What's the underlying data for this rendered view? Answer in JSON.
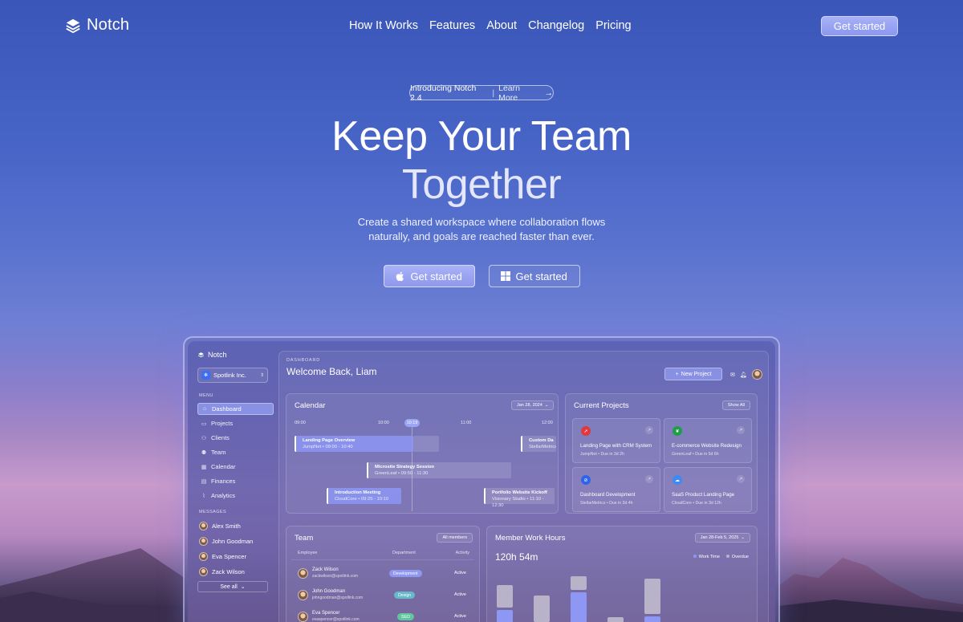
{
  "brand": {
    "name": "Notch",
    "logo_icon": "stacked-layers-icon"
  },
  "nav": {
    "links": [
      "How It Works",
      "Features",
      "About",
      "Changelog",
      "Pricing"
    ],
    "cta": "Get started"
  },
  "hero": {
    "pill_intro": "Introducing Notch 2.4",
    "pill_divider": "|",
    "pill_link": "Learn More",
    "title_line1": "Keep Your Team",
    "title_line2": "Together",
    "subtitle_line1": "Create a shared workspace where collaboration flows",
    "subtitle_line2": "naturally, and goals are reached faster than ever.",
    "cta_mac": {
      "label": "Get started",
      "icon": "apple-icon"
    },
    "cta_windows": {
      "label": "Get started",
      "icon": "windows-icon"
    }
  },
  "dashboard": {
    "brand": "Notch",
    "org": "Spotlink Inc.",
    "menu_heading": "MENU",
    "menu": [
      {
        "label": "Dashboard",
        "icon": "home-icon",
        "active": true
      },
      {
        "label": "Projects",
        "icon": "folder-icon"
      },
      {
        "label": "Clients",
        "icon": "users-icon"
      },
      {
        "label": "Team",
        "icon": "team-icon"
      },
      {
        "label": "Calendar",
        "icon": "calendar-icon"
      },
      {
        "label": "Finances",
        "icon": "wallet-icon"
      },
      {
        "label": "Analytics",
        "icon": "chart-icon"
      }
    ],
    "messages_heading": "MESSAGES",
    "messages": [
      "Alex Smith",
      "John Goodman",
      "Eva Spencer",
      "Zack Wilson"
    ],
    "see_all": "See all",
    "breadcrumb": "DASHBOARD",
    "welcome": "Welcome Back, Liam",
    "new_project": "New Project",
    "calendar": {
      "title": "Calendar",
      "date": "Jan 28, 2024",
      "times": [
        "09:00",
        "10:00",
        "11:00",
        "12:00"
      ],
      "now": "10:19",
      "events": [
        {
          "title": "Landing Page Overview",
          "meta": "JumpNet  •  09:00 - 10:40"
        },
        {
          "title": "Custom Da",
          "meta": "StellarMetrics"
        },
        {
          "title": "Microsite Strategy Session",
          "meta": "GreenLeaf  •  09:50 - 11:30"
        },
        {
          "title": "Introduction Meeting",
          "meta": "CloudCore  •  09:25 - 10:10"
        },
        {
          "title": "Portfolio Website Kickoff",
          "meta": "Visionary Studio  •  11:10 - 12:30"
        }
      ]
    },
    "projects": {
      "title": "Current Projects",
      "show_all": "Show All",
      "items": [
        {
          "title": "Landing Page with CRM System",
          "client": "JumpNet",
          "due": "Due in 3d 2h",
          "color": "#e0393f"
        },
        {
          "title": "E-commerce Website Redesign",
          "client": "GreenLeaf",
          "due": "Due in 5d 6h",
          "color": "#1f9d4a"
        },
        {
          "title": "Dashboard Development",
          "client": "StellarMetrics",
          "due": "Due in 3d 4h",
          "color": "#2f64e8"
        },
        {
          "title": "SaaS Product Landing Page",
          "client": "CloudCore",
          "due": "Due in 3d 12h",
          "color": "#3d8bf2"
        }
      ]
    },
    "team": {
      "title": "Team",
      "all_members": "All members",
      "headers": [
        "Employee",
        "Department",
        "Activity"
      ],
      "rows": [
        {
          "name": "Zack Wilson",
          "email": "zackwilson@spotlink.com",
          "department": "Development",
          "activity": "Active",
          "dept_color": "#8f97f0"
        },
        {
          "name": "John Goodman",
          "email": "johngoodman@spotlink.com",
          "department": "Design",
          "activity": "Active",
          "dept_color": "#67b8c9"
        },
        {
          "name": "Eva Spencer",
          "email": "evaspencer@spotlink.com",
          "department": "SEO",
          "activity": "Active",
          "dept_color": "#5fc79a"
        }
      ]
    },
    "hours": {
      "title": "Member Work Hours",
      "range": "Jan 28-Feb 5, 2025",
      "total": "120h 54m",
      "legend": [
        {
          "label": "Work Time",
          "color": "#8f97f5"
        },
        {
          "label": "Overdue",
          "color": "#b8b3c9"
        }
      ],
      "bars": [
        {
          "work": 0.45,
          "overdue": 0.35
        },
        {
          "work": 0.22,
          "overdue": 0.42
        },
        {
          "work": 0.72,
          "overdue": 0.22
        },
        {
          "work": 0.18,
          "overdue": 0.12
        },
        {
          "work": 0.35,
          "overdue": 0.55
        }
      ]
    }
  }
}
